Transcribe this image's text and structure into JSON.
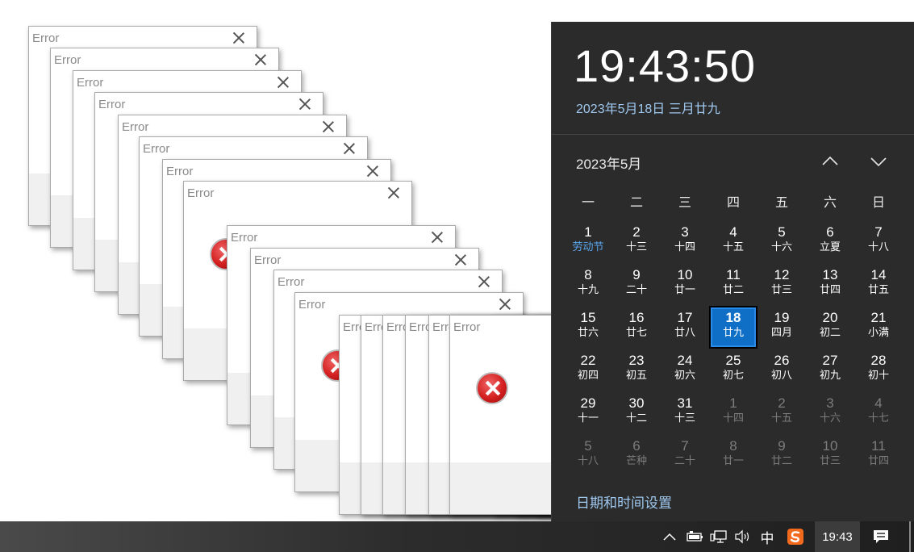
{
  "dialog_title": "Error",
  "flyout": {
    "time": "19:43:50",
    "date": "2023年5月18日 三月廿九",
    "month": "2023年5月",
    "weekdays": [
      "一",
      "二",
      "三",
      "四",
      "五",
      "六",
      "日"
    ],
    "days": [
      {
        "d": "1",
        "l": "劳动节",
        "type": "holiday"
      },
      {
        "d": "2",
        "l": "十三"
      },
      {
        "d": "3",
        "l": "十四"
      },
      {
        "d": "4",
        "l": "十五"
      },
      {
        "d": "5",
        "l": "十六"
      },
      {
        "d": "6",
        "l": "立夏"
      },
      {
        "d": "7",
        "l": "十八"
      },
      {
        "d": "8",
        "l": "十九"
      },
      {
        "d": "9",
        "l": "二十"
      },
      {
        "d": "10",
        "l": "廿一"
      },
      {
        "d": "11",
        "l": "廿二"
      },
      {
        "d": "12",
        "l": "廿三"
      },
      {
        "d": "13",
        "l": "廿四"
      },
      {
        "d": "14",
        "l": "廿五"
      },
      {
        "d": "15",
        "l": "廿六"
      },
      {
        "d": "16",
        "l": "廿七"
      },
      {
        "d": "17",
        "l": "廿八"
      },
      {
        "d": "18",
        "l": "廿九",
        "type": "today"
      },
      {
        "d": "19",
        "l": "四月"
      },
      {
        "d": "20",
        "l": "初二"
      },
      {
        "d": "21",
        "l": "小满"
      },
      {
        "d": "22",
        "l": "初四"
      },
      {
        "d": "23",
        "l": "初五"
      },
      {
        "d": "24",
        "l": "初六"
      },
      {
        "d": "25",
        "l": "初七"
      },
      {
        "d": "26",
        "l": "初八"
      },
      {
        "d": "27",
        "l": "初九"
      },
      {
        "d": "28",
        "l": "初十"
      },
      {
        "d": "29",
        "l": "十一"
      },
      {
        "d": "30",
        "l": "十二"
      },
      {
        "d": "31",
        "l": "十三"
      },
      {
        "d": "1",
        "l": "十四",
        "type": "other"
      },
      {
        "d": "2",
        "l": "十五",
        "type": "other"
      },
      {
        "d": "3",
        "l": "十六",
        "type": "other"
      },
      {
        "d": "4",
        "l": "十七",
        "type": "other"
      },
      {
        "d": "5",
        "l": "十八",
        "type": "other"
      },
      {
        "d": "6",
        "l": "芒种",
        "type": "other"
      },
      {
        "d": "7",
        "l": "二十",
        "type": "other"
      },
      {
        "d": "8",
        "l": "廿一",
        "type": "other"
      },
      {
        "d": "9",
        "l": "廿二",
        "type": "other"
      },
      {
        "d": "10",
        "l": "廿三",
        "type": "other"
      },
      {
        "d": "11",
        "l": "廿四",
        "type": "other"
      }
    ],
    "settings_link": "日期和时间设置"
  },
  "taskbar": {
    "ime": "中",
    "clock": "19:43",
    "icons": [
      "chevron-up-icon",
      "battery-icon",
      "network-icon",
      "volume-icon",
      "sogou-ime-icon",
      "action-center-icon"
    ]
  },
  "colors": {
    "flyout_bg": "#2b2b2b",
    "accent": "#0f6fc6",
    "link": "#9fc9f0",
    "error_red": "#d42020"
  }
}
